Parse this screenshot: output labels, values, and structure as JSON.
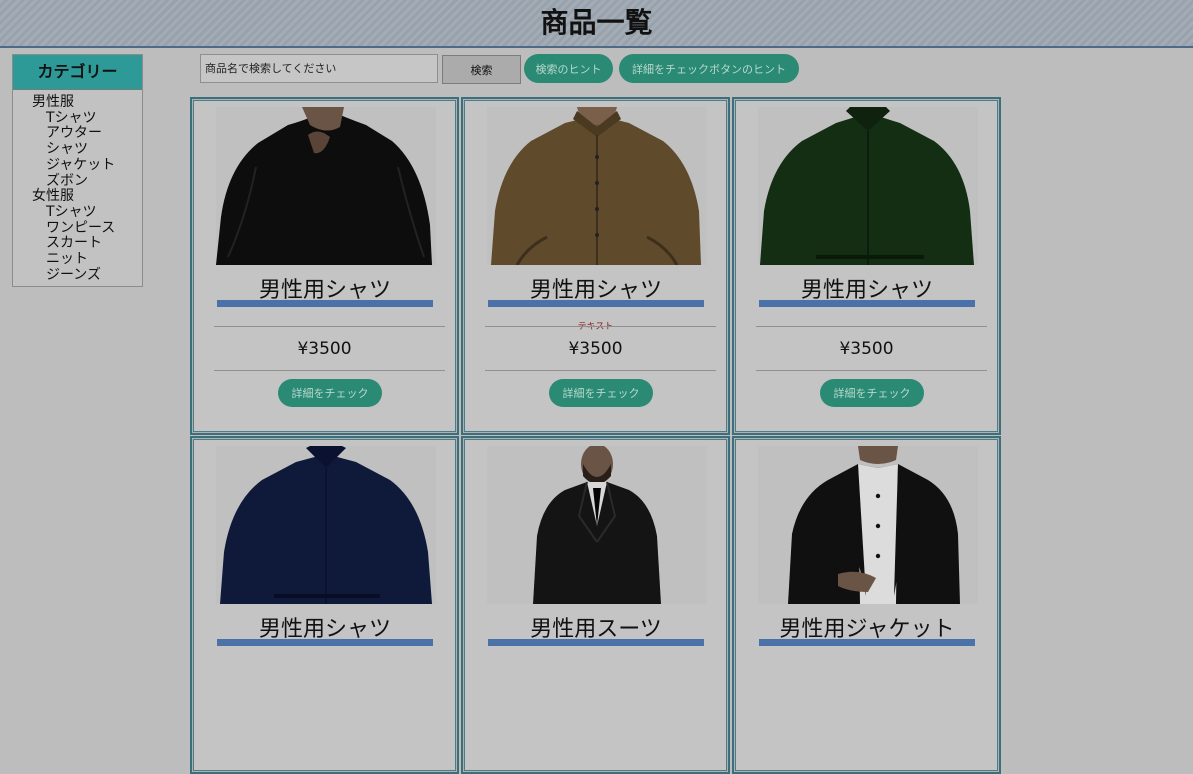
{
  "header": {
    "title": "商品一覧"
  },
  "sidebar": {
    "title": "カテゴリー",
    "groups": [
      {
        "label": "男性服",
        "items": [
          "Tシャツ",
          "アウター",
          "シャツ",
          "ジャケット",
          "ズボン"
        ]
      },
      {
        "label": "女性服",
        "items": [
          "Tシャツ",
          "ワンピース",
          "スカート",
          "ニット",
          "ジーンズ"
        ]
      }
    ]
  },
  "search": {
    "placeholder": "商品名で検索してください",
    "button_label": "検索",
    "hint_label": "検索のヒント",
    "detail_hint_label": "詳細をチェックボタンのヒント"
  },
  "products": [
    {
      "name": "男性用シャツ",
      "price": "¥3500",
      "note": "",
      "button": "詳細をチェック",
      "image": "black-shirt",
      "color": "#111111"
    },
    {
      "name": "男性用シャツ",
      "price": "¥3500",
      "note": "テキスト",
      "button": "詳細をチェック",
      "image": "brown-shirt",
      "color": "#6b5434"
    },
    {
      "name": "男性用シャツ",
      "price": "¥3500",
      "note": "",
      "button": "詳細をチェック",
      "image": "green-shirt",
      "color": "#163616"
    },
    {
      "name": "男性用シャツ",
      "price": "",
      "note": "",
      "button": "",
      "image": "navy-shirt",
      "color": "#101a3a"
    },
    {
      "name": "男性用スーツ",
      "price": "",
      "note": "",
      "button": "",
      "image": "black-suit",
      "color": "#151515"
    },
    {
      "name": "男性用ジャケット",
      "price": "",
      "note": "",
      "button": "",
      "image": "black-jacket",
      "color": "#121212"
    }
  ],
  "colors": {
    "accent_green": "#2a8a73",
    "sidebar_header": "#2d9a98",
    "name_underline": "#4a72a8",
    "header_border": "#4e6a84"
  }
}
